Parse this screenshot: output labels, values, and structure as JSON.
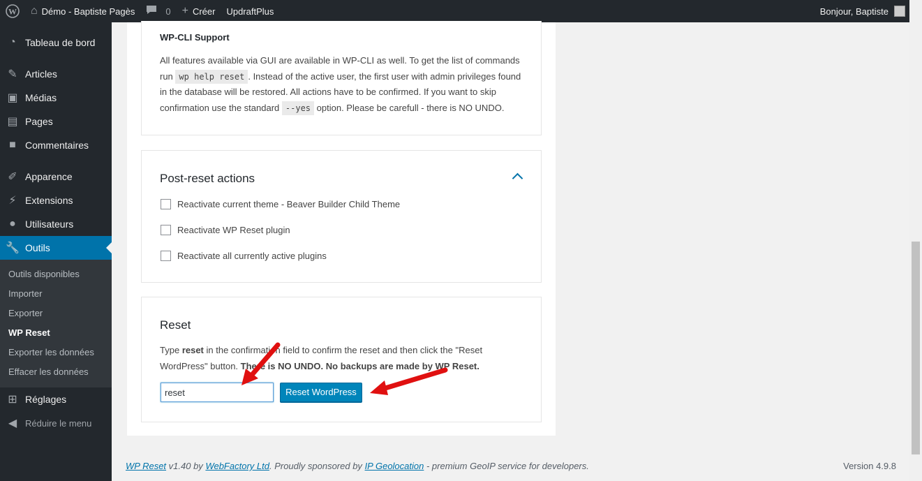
{
  "adminbar": {
    "site_name": "Démo - Baptiste Pagès",
    "comments_count": "0",
    "new_label": "Créer",
    "plugin_label": "UpdraftPlus",
    "greeting": "Bonjour, Baptiste"
  },
  "sidebar": {
    "items": [
      {
        "label": "Tableau de bord",
        "icon": "dashboard-icon"
      },
      {
        "label": "Articles",
        "icon": "pin-icon"
      },
      {
        "label": "Médias",
        "icon": "media-icon"
      },
      {
        "label": "Pages",
        "icon": "page-icon"
      },
      {
        "label": "Commentaires",
        "icon": "comment-icon"
      },
      {
        "label": "Apparence",
        "icon": "brush-icon"
      },
      {
        "label": "Extensions",
        "icon": "plugin-icon"
      },
      {
        "label": "Utilisateurs",
        "icon": "user-icon"
      },
      {
        "label": "Outils",
        "icon": "wrench-icon"
      },
      {
        "label": "Réglages",
        "icon": "settings-icon"
      }
    ],
    "submenu": [
      "Outils disponibles",
      "Importer",
      "Exporter",
      "WP Reset",
      "Exporter les données",
      "Effacer les données"
    ],
    "collapse_label": "Réduire le menu"
  },
  "wpcli": {
    "title": "WP-CLI Support",
    "text1": "All features available via GUI are available in WP-CLI as well. To get the list of commands run",
    "code1": "wp help reset",
    "text2": ". Instead of the active user, the first user with admin privileges found in the database will be restored. All actions have to be confirmed. If you want to skip confirmation use the standard",
    "code2": "--yes",
    "text3": "option. Please be carefull - there is NO UNDO."
  },
  "post_reset": {
    "title": "Post-reset actions",
    "options": [
      "Reactivate current theme - Beaver Builder Child Theme",
      "Reactivate WP Reset plugin",
      "Reactivate all currently active plugins"
    ]
  },
  "reset": {
    "title": "Reset",
    "text_a": "Type",
    "keyword": "reset",
    "text_b": "in the confirmation field to confirm the reset and then click the \"Reset WordPress\" button.",
    "warning": "There is NO UNDO. No backups are made by WP Reset.",
    "input_value": "reset",
    "button_label": "Reset WordPress"
  },
  "footer": {
    "plugin_link": "WP Reset",
    "text1": "v1.40 by",
    "company_link": "WebFactory Ltd",
    "text2": ". Proudly sponsored by",
    "sponsor_link": "IP Geolocation",
    "text3": "- premium GeoIP service for developers.",
    "version": "Version 4.9.8"
  },
  "colors": {
    "admin_dark": "#23282d",
    "submenu_bg": "#32373c",
    "accent": "#0073aa",
    "button": "#0085ba",
    "arrow": "#e01010"
  }
}
